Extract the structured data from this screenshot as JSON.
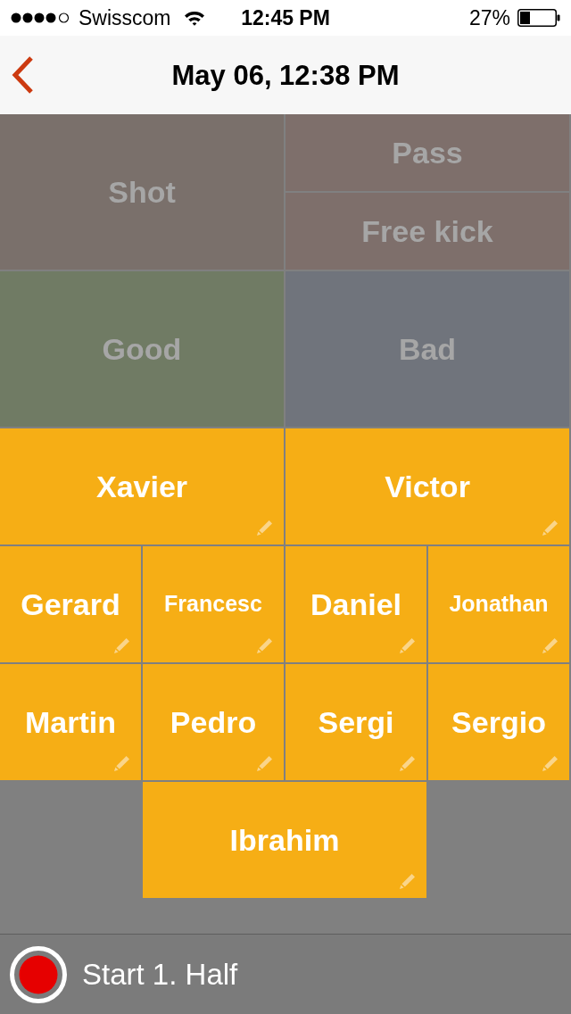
{
  "status_bar": {
    "carrier": "Swisscom",
    "time": "12:45 PM",
    "battery": "27%"
  },
  "nav_bar": {
    "title": "May 06, 12:38 PM"
  },
  "event_types": [
    {
      "label": "Shot",
      "color": "#7a706b",
      "disabled": true
    },
    {
      "label": "Pass",
      "color": "#7e6f6b",
      "disabled": true
    },
    {
      "label": "Free kick",
      "color": "#7e6f6b",
      "disabled": true
    }
  ],
  "outcomes": [
    {
      "label": "Good",
      "color": "#707b64",
      "disabled": true
    },
    {
      "label": "Bad",
      "color": "#70747c",
      "disabled": true
    }
  ],
  "players": [
    {
      "name": "Xavier"
    },
    {
      "name": "Victor"
    },
    {
      "name": "Gerard"
    },
    {
      "name": "Francesc"
    },
    {
      "name": "Daniel"
    },
    {
      "name": "Jonathan"
    },
    {
      "name": "Martin"
    },
    {
      "name": "Pedro"
    },
    {
      "name": "Sergi"
    },
    {
      "name": "Sergio"
    },
    {
      "name": "Ibrahim"
    }
  ],
  "footer": {
    "label": "Start 1. Half"
  }
}
